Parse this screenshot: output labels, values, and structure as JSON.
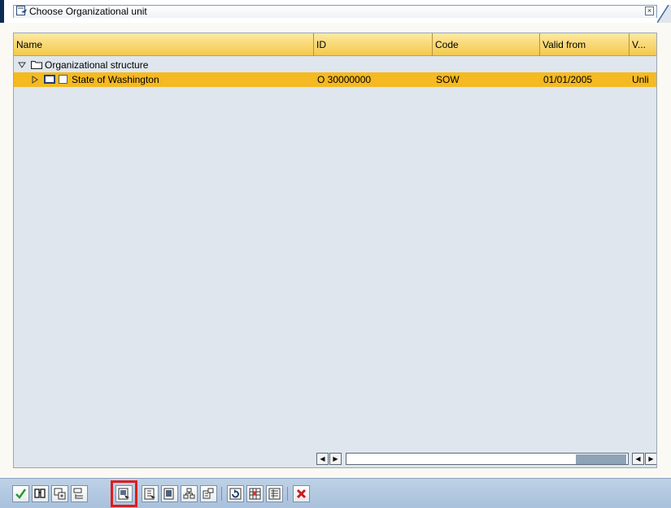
{
  "window": {
    "title": "Choose Organizational unit"
  },
  "table": {
    "columns": [
      "Name",
      "ID",
      "Code",
      "Valid from",
      "V..."
    ],
    "rows": [
      {
        "name": "Organizational structure",
        "expanded": true,
        "level": 0,
        "id": "",
        "code": "",
        "valid_from": "",
        "valid_to": ""
      },
      {
        "name": "State of Washington",
        "expanded": false,
        "level": 1,
        "id": "O  30000000",
        "code": "SOW",
        "valid_from": "01/01/2005",
        "valid_to": "Unli",
        "selected": true
      }
    ]
  },
  "toolbar": {
    "buttons": [
      {
        "icon": "check-icon",
        "tooltip": "Continue"
      },
      {
        "icon": "find-icon",
        "tooltip": "Find"
      },
      {
        "icon": "expand-subtree-icon",
        "tooltip": "Expand subtree"
      },
      {
        "icon": "collapse-subtree-icon",
        "tooltip": "Collapse subtree"
      },
      {
        "icon": "select-block-icon",
        "tooltip": "Select block",
        "highlighted": true
      },
      {
        "icon": "select-all-icon",
        "tooltip": "Select all"
      },
      {
        "icon": "deselect-all-icon",
        "tooltip": "Deselect all"
      },
      {
        "icon": "hierarchy-icon",
        "tooltip": "Hierarchy"
      },
      {
        "icon": "structure-icon",
        "tooltip": "Structure"
      },
      {
        "icon": "refresh-icon",
        "tooltip": "Refresh"
      },
      {
        "icon": "column-config-icon",
        "tooltip": "Columns"
      },
      {
        "icon": "details-icon",
        "tooltip": "Details"
      },
      {
        "icon": "cancel-icon",
        "tooltip": "Cancel"
      }
    ]
  },
  "colors": {
    "header_bg": "#f4c94a",
    "selection_bg": "#f5b921",
    "tree_bg": "#dfe6ed",
    "toolbar_bg": "#b3c9e1",
    "highlight_box": "#e01b1b"
  }
}
